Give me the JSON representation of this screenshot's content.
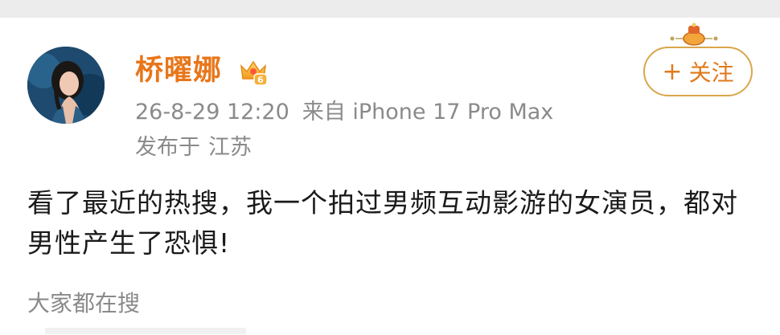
{
  "user": {
    "name": "桥曜娜",
    "vip_level": "6"
  },
  "post": {
    "timestamp": "26-8-29 12:20",
    "source": "来自 iPhone 17 Pro Max",
    "location_prefix": "发布于",
    "location": "江苏",
    "text": "看了最近的热搜，我一个拍过男频互动影游的女演员，都对男性产生了恐惧!"
  },
  "follow_button": {
    "plus": "+",
    "label": "关注"
  },
  "trending": {
    "label": "大家都在搜"
  },
  "colors": {
    "username": "#e8761a",
    "follow_border": "#d9a64a",
    "follow_text": "#e07a1c",
    "meta_text": "#8a8a8a",
    "body_text": "#1a1a1a"
  },
  "icons": {
    "badge": "vip-crown-icon",
    "decor": "follow-decoration-icon"
  }
}
